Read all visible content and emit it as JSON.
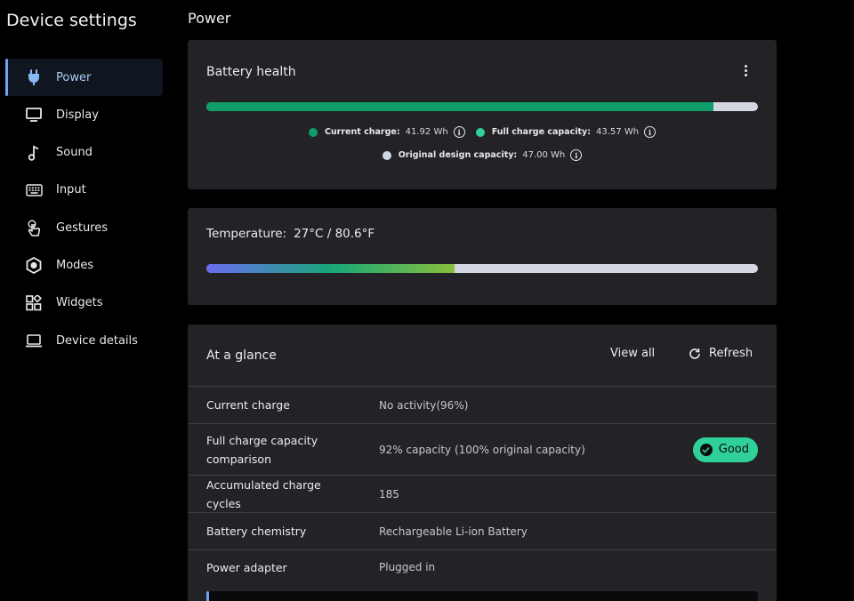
{
  "app": {
    "title": "Device settings"
  },
  "sidebar": {
    "items": [
      {
        "label": "Power",
        "icon": "plug-icon",
        "active": true
      },
      {
        "label": "Display",
        "icon": "monitor-icon"
      },
      {
        "label": "Sound",
        "icon": "music-note-icon"
      },
      {
        "label": "Input",
        "icon": "keyboard-icon"
      },
      {
        "label": "Gestures",
        "icon": "touch-hand-icon"
      },
      {
        "label": "Modes",
        "icon": "hexagon-icon"
      },
      {
        "label": "Widgets",
        "icon": "widgets-grid-icon"
      },
      {
        "label": "Device details",
        "icon": "laptop-icon"
      }
    ]
  },
  "page": {
    "title": "Power"
  },
  "battery": {
    "title": "Battery health",
    "fill_fraction": 0.92,
    "legend": {
      "current_label": "Current charge:",
      "current_value": "41.92 Wh",
      "full_label": "Full charge capacity:",
      "full_value": "43.57 Wh",
      "design_label": "Original design capacity:",
      "design_value": "47.00 Wh"
    }
  },
  "temperature": {
    "label": "Temperature:",
    "value": "27°C / 80.6°F",
    "fill_fraction": 0.45
  },
  "glance": {
    "title": "At a glance",
    "view_all": "View all",
    "refresh": "Refresh",
    "rows": [
      {
        "key": "Current charge",
        "value": "No activity(96%)"
      },
      {
        "key": "Full charge capacity comparison",
        "value": "92% capacity (100% original capacity)",
        "badge": "Good"
      },
      {
        "key": "Accumulated charge cycles",
        "value": "185"
      },
      {
        "key": "Battery chemistry",
        "value": "Rechargeable Li-ion Battery"
      },
      {
        "key": "Power adapter",
        "value": "Plugged in"
      }
    ]
  },
  "colors": {
    "accent": "#6ea6ec",
    "current_dot": "#109d69",
    "full_dot": "#2fd198",
    "design_dot": "#d2d7e2",
    "good_badge": "#2fd198"
  }
}
